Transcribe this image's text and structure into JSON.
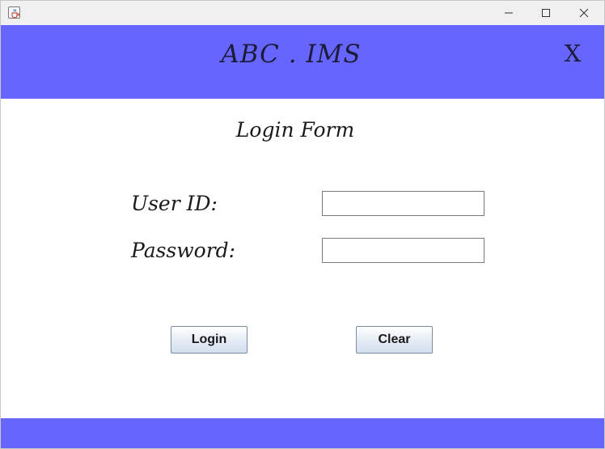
{
  "window": {
    "title": "",
    "icon": "java-cup-icon",
    "controls": [
      "minimize-icon",
      "maximize-icon",
      "close-icon"
    ]
  },
  "header": {
    "title": "ABC . IMS",
    "close_label": "X",
    "background": "#6666ff"
  },
  "form": {
    "title": "Login Form",
    "userid_label": "User ID:",
    "userid_value": "",
    "password_label": "Password:",
    "password_value": "",
    "login_button": "Login",
    "clear_button": "Clear"
  },
  "footer": {
    "background": "#6666ff"
  }
}
